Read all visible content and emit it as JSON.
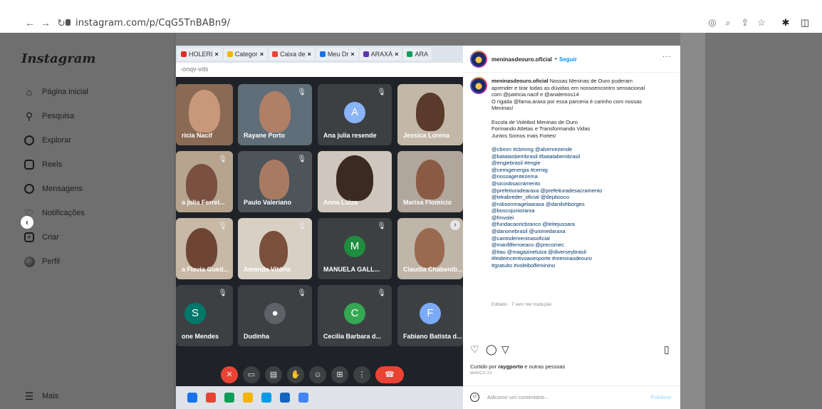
{
  "browser": {
    "url": "instagram.com/p/CqG5TnBABn9/"
  },
  "sidebar": {
    "logo": "Instagram",
    "items": [
      {
        "label": "Página inicial",
        "icon": "home-icon"
      },
      {
        "label": "Pesquisa",
        "icon": "search-icon"
      },
      {
        "label": "Explorar",
        "icon": "compass-icon"
      },
      {
        "label": "Reels",
        "icon": "reels-icon"
      },
      {
        "label": "Mensagens",
        "icon": "messenger-icon"
      },
      {
        "label": "Notificações",
        "icon": "heart-icon"
      },
      {
        "label": "Criar",
        "icon": "plus-icon"
      },
      {
        "label": "Perfil",
        "icon": "avatar"
      }
    ],
    "more_label": "Mais"
  },
  "post_image": {
    "tabs": [
      {
        "label": "HOLERI",
        "color": "#d93025"
      },
      {
        "label": "Categor",
        "color": "#f4b400"
      },
      {
        "label": "Caixa de",
        "color": "#ea4335"
      },
      {
        "label": "Meu Dr",
        "color": "#1a73e8"
      },
      {
        "label": "ARAXÁ",
        "color": "#5e35b1"
      },
      {
        "label": "ARA",
        "color": "#0f9d58"
      }
    ],
    "url_fragment": "-onqv-vds",
    "participants": [
      {
        "name": "ricia Nacif"
      },
      {
        "name": "Rayane Porto"
      },
      {
        "name": "Ana julia resende",
        "letter": "A",
        "color": "#8ab4f8"
      },
      {
        "name": "Jessica Lorena"
      },
      {
        "name": "a julia Ferrei..."
      },
      {
        "name": "Paulo Valeriano"
      },
      {
        "name": "Anna Luiza"
      },
      {
        "name": "Marisa Flomicio"
      },
      {
        "name": "a Flavia Gued..."
      },
      {
        "name": "Amanda Vitória"
      },
      {
        "name": "MANUELA GALL...",
        "letter": "M",
        "color": "#1e8e3e"
      },
      {
        "name": "Claudia Chabenib..."
      },
      {
        "name": "one Mendes",
        "letter": "S",
        "color": "#00796b"
      },
      {
        "name": "Dudinha"
      },
      {
        "name": "Cecilia Barbara d...",
        "letter": "C",
        "color": "#34a853"
      },
      {
        "name": "Fabiano Batista d...",
        "letter": "F",
        "color": "#7baaf7"
      }
    ]
  },
  "post": {
    "username": "meninasdeouro.oficial",
    "follow_label": "Seguir",
    "caption_lines": [
      "Nossas Meninas de Ouro puderam",
      "aprender e tirar todas as dúvidas em nossoencontro sensacional",
      "com @patricia.nacif e @analemos14",
      "O rigada @fama.araxa por essa parceria é carinho com nossas",
      "Meninas!",
      "",
      "Escola de Voleibol Meninas de Ouro",
      "Formando Atletas e Transformando Vidas",
      "Juntos Somos mais Fortes!",
      "",
      "@cbmm #cbmmg @alvimrezende",
      "@batatasbembrasil #batatabembrasil",
      "@engiebrasil #engie",
      "@cemigenergia #cemig",
      "@nossagentezema",
      "@sicoobsacramento",
      "@prefeituradearaxa @prefeituradesacramento",
      "@tekabreder_oficial @depbosco",
      "@robsonmagelaaraxa @danilohborges",
      "@boscojuniorarxa",
      "@fmvolei",
      "@fundacaoricbranco @leitejussara",
      "@danonebrasil @unimedaraxa",
      "@cantodemeninasoficial",
      "@manfilferroeaco @precomec",
      "@itau @magazineluiza @diverseybrasil",
      "#leideincentivoaoesporte #meninasdeouro",
      "#gratuito #voleibolfeminino"
    ],
    "meta": "Editado · 7 sem   Ver tradução",
    "liked_prefix": "Curtido por ",
    "liked_user": "raygporto",
    "liked_suffix": " e outras pessoas",
    "date": "MARÇO 22",
    "comment_placeholder": "Adicione um comentário...",
    "publish_label": "Publicar"
  }
}
